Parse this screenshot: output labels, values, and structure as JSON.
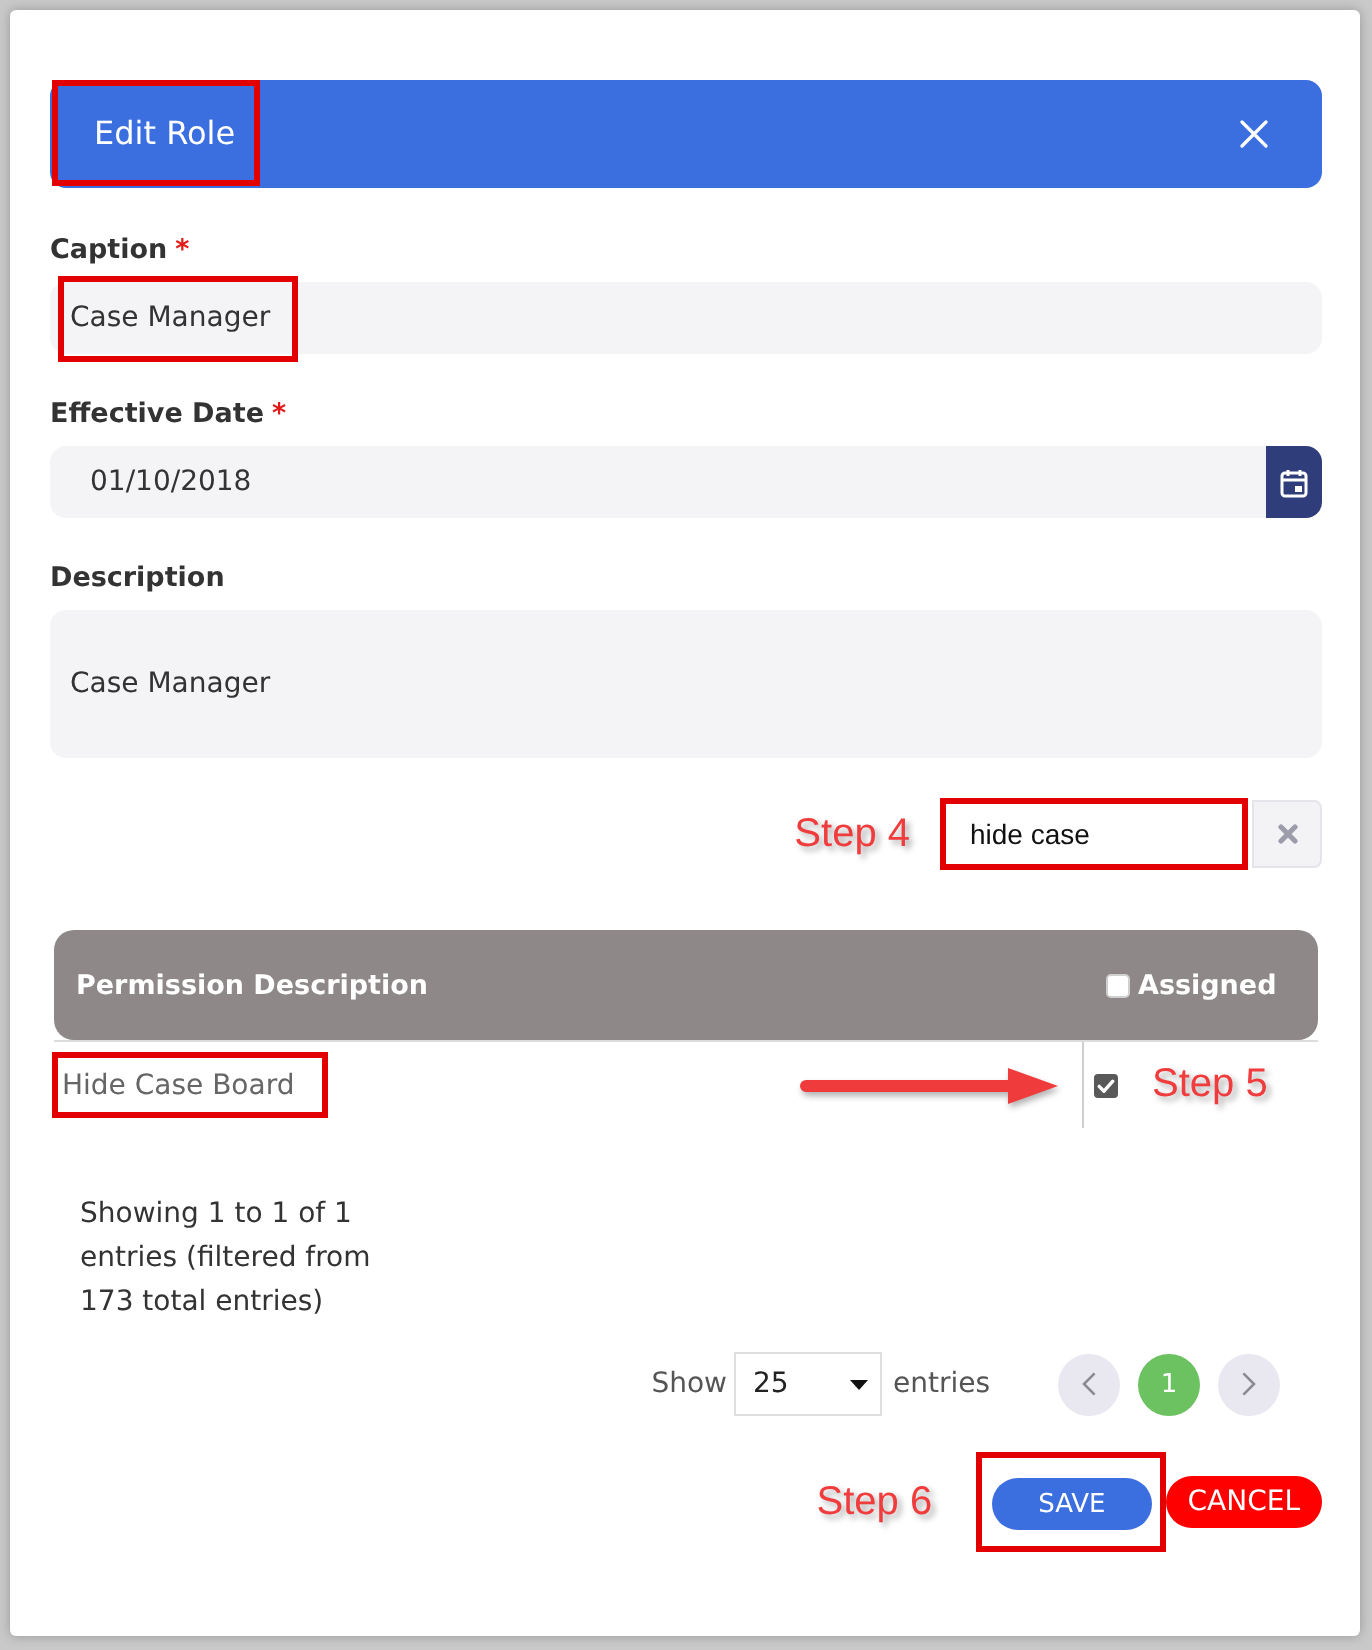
{
  "dialog": {
    "title": "Edit Role",
    "title_highlighted": true
  },
  "fields": [
    {
      "kind": "text",
      "label": "Caption",
      "required_mark": "*",
      "value": "Case Manager",
      "highlighted": true
    },
    {
      "kind": "date",
      "label": "Effective Date",
      "required_mark": "*",
      "value": "01/10/2018",
      "highlighted": false
    },
    {
      "kind": "textarea",
      "label": "Description",
      "value": "Case Manager",
      "highlighted": false
    }
  ],
  "search": {
    "annotation": "Step 4",
    "value": "hide case",
    "highlighted": true
  },
  "table": {
    "columns": [
      {
        "label": "Permission Description"
      },
      {
        "label": "Assigned"
      }
    ],
    "select_all_checked": false,
    "rows": [
      {
        "permission": "Hide Case Board",
        "highlighted": true,
        "arrow": true,
        "assigned": true,
        "annotation": "Step 5"
      }
    ]
  },
  "summary": "Showing 1 to 1 of 1 entries (filtered from 173 total entries)",
  "pagination": {
    "show_label": "Show",
    "page_size": "25",
    "entries_label": "entries",
    "pages": [
      {
        "label": "1",
        "selected": true
      }
    ]
  },
  "actions": {
    "annotation": "Step 6",
    "buttons": [
      {
        "kind": "save",
        "label": "SAVE",
        "highlighted": true
      },
      {
        "kind": "cancel",
        "label": "CANCEL",
        "highlighted": false
      }
    ]
  }
}
